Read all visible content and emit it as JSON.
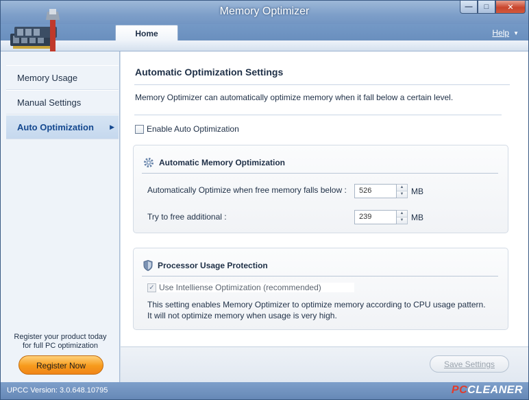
{
  "window": {
    "title": "Memory Optimizer"
  },
  "tabs": [
    {
      "label": "Home"
    }
  ],
  "help_label": "Help",
  "sidebar": {
    "items": [
      {
        "label": "Memory Usage"
      },
      {
        "label": "Manual Settings"
      },
      {
        "label": "Auto Optimization"
      }
    ],
    "register_text_line1": "Register your product today",
    "register_text_line2": "for full PC optimization",
    "register_button": "Register Now"
  },
  "main": {
    "heading": "Automatic Optimization Settings",
    "description": "Memory Optimizer can automatically optimize memory when it fall below a certain level.",
    "enable_label": "Enable Auto Optimization",
    "group1": {
      "title": "Automatic Memory Optimization",
      "row1_label": "Automatically Optimize when free memory falls below :",
      "row1_value": "526",
      "row1_unit": "MB",
      "row2_label": "Try to free additional :",
      "row2_value": "239",
      "row2_unit": "MB"
    },
    "group2": {
      "title": "Processor Usage Protection",
      "intel_label": "Use Intelliense Optimization (recommended)",
      "note_line1": "This setting enables Memory Optimizer to optimize memory according to CPU usage pattern.",
      "note_line2": "It will not optimize memory when usage is very high."
    },
    "save_button": "Save Settings"
  },
  "status": {
    "version": "UPCC Version: 3.0.648.10795",
    "brand_pc": "PC",
    "brand_cleaner": "CLEANER"
  },
  "colors": {
    "accent": "#14488f",
    "register": "#f79a1b",
    "title_bar": "#7e9fc9"
  }
}
